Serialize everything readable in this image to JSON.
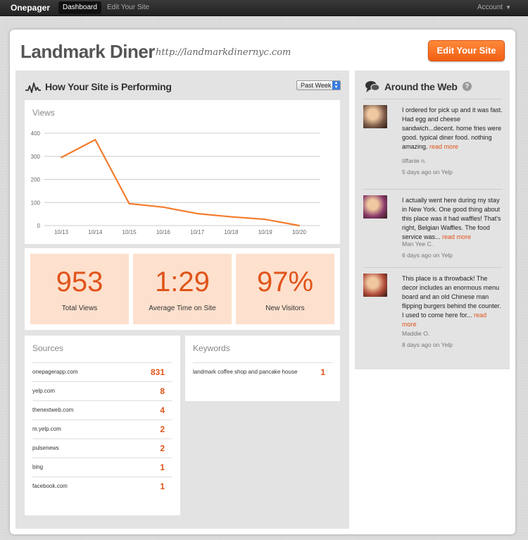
{
  "topbar": {
    "brand": "Onepager",
    "nav": [
      {
        "label": "Dashboard",
        "active": true
      },
      {
        "label": "Edit Your Site",
        "active": false
      }
    ],
    "account_label": "Account"
  },
  "site": {
    "title": "Landmark Diner",
    "url": "http://landmarkdinernyc.com",
    "edit_button": "Edit Your Site"
  },
  "performance": {
    "heading": "How Your Site is Performing",
    "period": "Past Week",
    "views_title": "Views",
    "chart_data": {
      "type": "line",
      "title": "Views",
      "x": [
        "10/13",
        "10/14",
        "10/15",
        "10/16",
        "10/17",
        "10/18",
        "10/19",
        "10/20"
      ],
      "y_ticks": [
        0,
        100,
        200,
        300,
        400
      ],
      "ylim": [
        0,
        400
      ],
      "series": [
        {
          "values": [
            295,
            372,
            95,
            80,
            52,
            38,
            27,
            0
          ],
          "color": "#f47c2c"
        }
      ],
      "grid": true
    },
    "stats": [
      {
        "value": "953",
        "label": "Total Views"
      },
      {
        "value": "1:29",
        "label": "Average Time on Site"
      },
      {
        "value": "97%",
        "label": "New Visitors"
      }
    ]
  },
  "sources": {
    "title": "Sources",
    "rows": [
      {
        "label": "onepagerapp.com",
        "value": "831"
      },
      {
        "label": "yelp.com",
        "value": "8"
      },
      {
        "label": "thenextweb.com",
        "value": "4"
      },
      {
        "label": "m.yelp.com",
        "value": "2"
      },
      {
        "label": "pulsenews",
        "value": "2"
      },
      {
        "label": "bing",
        "value": "1"
      },
      {
        "label": "facebook.com",
        "value": "1"
      }
    ]
  },
  "keywords": {
    "title": "Keywords",
    "rows": [
      {
        "label": "landmark coffee shop and pancake house",
        "value": "1"
      }
    ]
  },
  "web": {
    "heading": "Around the Web",
    "help": "?",
    "reviews": [
      {
        "text": "I ordered for pick up and it was fast. Had egg and cheese sandwich...decent. home fries were good. typical diner food. nothing amazing.",
        "more": "read more",
        "author": "tiffanie n.",
        "meta": "5 days ago on Yelp",
        "avatar_color": "#7a5a48"
      },
      {
        "text": "I actually went here during my stay in New York. One good thing about this place was it had waffles! That's right, Belgian Waffles. The food service was...",
        "more": "read more",
        "author": "Man Yee C.",
        "meta": "6 days ago on Yelp",
        "avatar_color": "#8a3a6a"
      },
      {
        "text": "This place is a throwback! The decor includes an enormous menu board and an old Chinese man flipping burgers behind the counter. I used to come here for...",
        "more": "read more",
        "author": "Maddie O.",
        "meta": "8 days ago on Yelp",
        "avatar_color": "#b04a3a"
      }
    ]
  }
}
